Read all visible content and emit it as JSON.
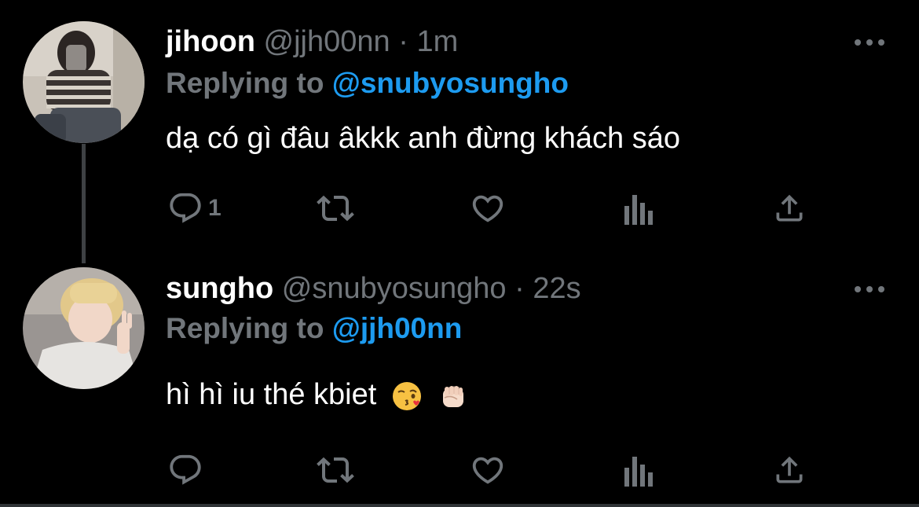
{
  "theme": {
    "background": "#000000",
    "text_primary": "#ffffff",
    "text_secondary": "#71767b",
    "link": "#1d9bf0",
    "thread_line": "#3e4144"
  },
  "tweets": [
    {
      "name": "jihoon",
      "handle": "@jjh00nn",
      "separator": "·",
      "time": "1m",
      "replying_label": "Replying to",
      "replying_to": "@snubyosungho",
      "text": "dạ có gì đâu âkkk anh đừng khách sáo",
      "emojis": [],
      "reply_count": "1",
      "avatar_icon": "avatar-photo"
    },
    {
      "name": "sungho",
      "handle": "@snubyosungho",
      "separator": "·",
      "time": "22s",
      "replying_label": "Replying to",
      "replying_to": "@jjh00nn",
      "text": "hì hì iu thé kbiet",
      "emojis": [
        "kissing-face-emoji",
        "raised-fist-emoji"
      ],
      "reply_count": "",
      "avatar_icon": "avatar-photo"
    }
  ],
  "icons": [
    "reply-icon",
    "retweet-icon",
    "like-icon",
    "views-icon",
    "share-icon",
    "more-icon"
  ]
}
